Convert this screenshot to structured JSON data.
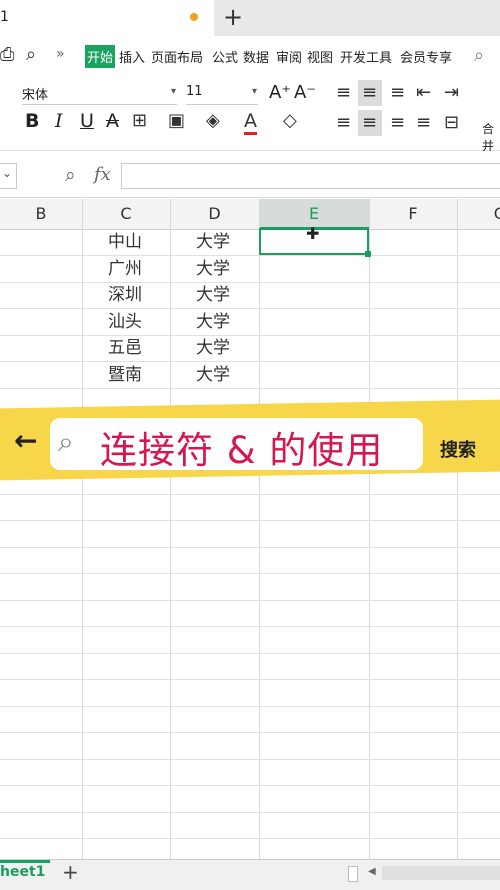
{
  "tab": {
    "title": "1",
    "new_tab": "+"
  },
  "menu": [
    "开始",
    "插入",
    "页面布局",
    "公式",
    "数据",
    "审阅",
    "视图",
    "开发工具",
    "会员专享"
  ],
  "menu_more": "»",
  "ribbon": {
    "font_name": "宋体",
    "font_size": "11",
    "increase_font": "A⁺",
    "decrease_font": "A⁻",
    "bold": "B",
    "italic": "I",
    "underline": "U",
    "strike": "A",
    "font_color": "A",
    "merge_label": "合并"
  },
  "formula_bar": {
    "cancel_glyph": "⌄",
    "fx": "fx",
    "value": ""
  },
  "columns": [
    "B",
    "C",
    "D",
    "E",
    "F",
    "G"
  ],
  "selected_column": "E",
  "rows": [
    {
      "c": "中山",
      "d": "大学"
    },
    {
      "c": "广州",
      "d": "大学"
    },
    {
      "c": "深圳",
      "d": "大学"
    },
    {
      "c": "汕头",
      "d": "大学"
    },
    {
      "c": "五邑",
      "d": "大学"
    },
    {
      "c": "暨南",
      "d": "大学"
    }
  ],
  "overlay": {
    "text": "连接符 & 的使用",
    "search_button": "搜索",
    "back": "←"
  },
  "sheet": {
    "name": "heet1",
    "add": "+"
  },
  "colors": {
    "accent": "#1b9e5e",
    "banner": "#f7d64a",
    "banner_text": "#d6174d"
  }
}
